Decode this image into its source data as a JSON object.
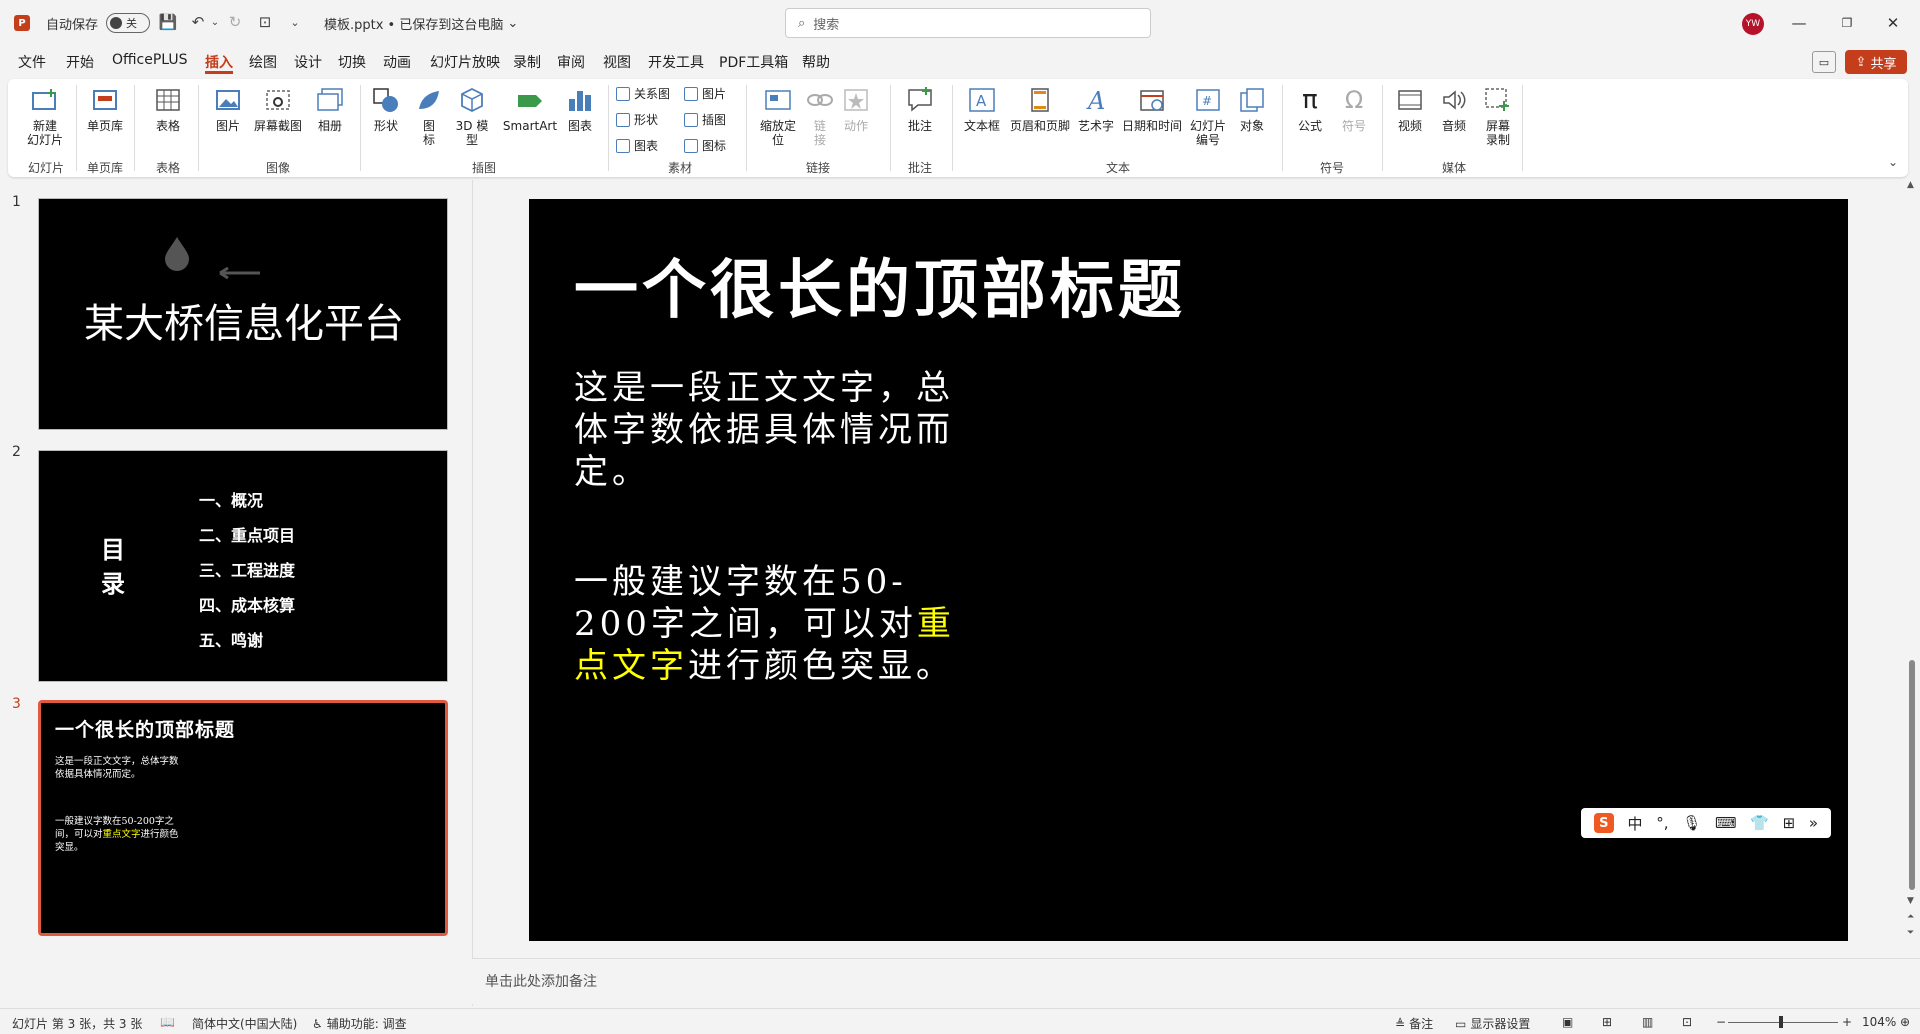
{
  "titlebar": {
    "autosave_label": "自动保存",
    "autosave_state": "关",
    "doc_title": "模板.pptx • 已保存到这台电脑",
    "search_placeholder": "搜索",
    "user_initials": "YW"
  },
  "menu": [
    "文件",
    "开始",
    "OfficePLUS",
    "插入",
    "绘图",
    "设计",
    "切换",
    "动画",
    "幻灯片放映",
    "录制",
    "审阅",
    "视图",
    "开发工具",
    "PDF工具箱",
    "帮助"
  ],
  "active_menu": "插入",
  "share_label": "共享",
  "ribbon": {
    "new_slide": "新建\n幻灯片",
    "slide_lib": "单页库",
    "table": "表格",
    "picture": "图片",
    "screenshot": "屏幕截图",
    "album": "相册",
    "shapes": "形状",
    "icons": "图\n标",
    "model3d": "3D 模\n型",
    "smartart": "SmartArt",
    "chart": "图表",
    "mat_relation": "关系图",
    "mat_shape": "形状",
    "mat_chart": "图表",
    "mat_picture": "图片",
    "mat_illustration": "插图",
    "mat_icon": "图标",
    "zoom": "缩放定\n位",
    "link": "链\n接",
    "action": "动作",
    "comment": "批注",
    "textbox": "文本框",
    "header_footer": "页眉和页脚",
    "wordart": "艺术字",
    "datetime": "日期和时间",
    "slide_number": "幻灯片\n编号",
    "object": "对象",
    "equation": "公式",
    "symbol": "符号",
    "video": "视频",
    "audio": "音频",
    "screen_record": "屏幕\n录制",
    "groups": {
      "slides": "幻灯片",
      "slide_lib": "单页库",
      "table": "表格",
      "images": "图像",
      "illustrations": "插图",
      "materials": "素材",
      "links": "链接",
      "comments": "批注",
      "text": "文本",
      "symbols": "符号",
      "media": "媒体"
    }
  },
  "thumbnails": [
    {
      "num": "1",
      "title": "某大桥信息化平台"
    },
    {
      "num": "2",
      "toc_title": "目\n录",
      "items": [
        "一、概况",
        "二、重点项目",
        "三、工程进度",
        "四、成本核算",
        "五、鸣谢"
      ]
    },
    {
      "num": "3",
      "title": "一个很长的顶部标题",
      "p1": "这是一段正文文字，总体字数依据具体情况而定。",
      "p2a": "一般建议字数在50-200字之间，可以对",
      "p2hl": "重点文字",
      "p2b": "进行颜色突显。"
    }
  ],
  "slide": {
    "title": "一个很长的顶部标题",
    "para1": "这是一段正文文字，总体字数依据具体情况而定。",
    "para2_pre": "一般建议字数在50-200字之间，可以对",
    "para2_highlight": "重点文字",
    "para2_post": "进行颜色突显。",
    "highlight_color": "#ffff00"
  },
  "ime_bar": {
    "mode": "中"
  },
  "notes_placeholder": "单击此处添加备注",
  "statusbar": {
    "slide_info": "幻灯片 第 3 张，共 3 张",
    "language": "简体中文(中国大陆)",
    "accessibility": "辅助功能: 调查",
    "notes": "备注",
    "display_settings": "显示器设置",
    "zoom": "104%"
  }
}
